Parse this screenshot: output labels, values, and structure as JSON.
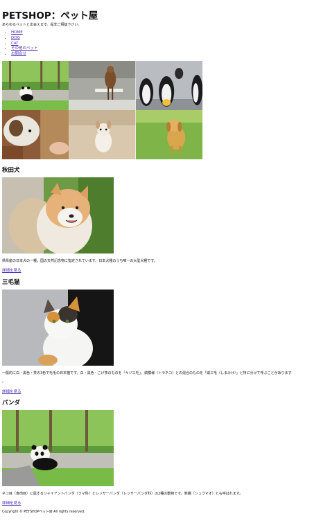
{
  "site": {
    "title": "PETSHOP：ペット屋",
    "lead": "あらゆるペットと出会えます。是非ご相談下さい。"
  },
  "nav": {
    "items": [
      "HOME",
      "DOG",
      "CAT",
      "その他のペット",
      "お問合せ"
    ]
  },
  "gallery": {
    "tiles": [
      "panda-photo",
      "hawk-photo",
      "penguins-photo",
      "dog-with-hand-photo",
      "chihuahua-photo",
      "golden-dog-photo"
    ]
  },
  "sections": [
    {
      "title": "秋田犬",
      "description": "県県産の日本犬の一種。国の天然記念物に指定されています。日本犬種のうち唯一の大型犬種です。",
      "more_label": "詳細を見る"
    },
    {
      "title": "三毛猫",
      "description": "一般的に白・黒色・茶の3色で毛毛の日本猫です。白・黒色・こげ茶のものを「キジ三毛」、縞模様（トラネコ）との混合のものを「縞三毛（しまみけ）」と特に分けて呼ぶことがあります",
      "trailing": "。",
      "more_label": "詳細を見る"
    },
    {
      "title": "パンダ",
      "description": "ネコ目（食肉目）に属するジャイアントパンダ（クマ科）とレッサーパンダ（レッサーパンダ科）の2種の動物です。熊猫（シュウマオ）とも呼ばれます。",
      "more_label": "詳細を見る"
    }
  ],
  "footer": {
    "copyright": "Copyright © PETSHOPペット屋 All rights reserved."
  }
}
